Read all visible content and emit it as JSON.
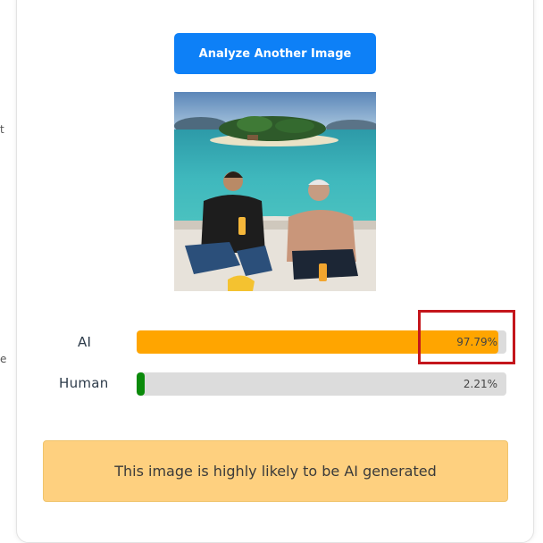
{
  "left_edge_fragments": [
    "t",
    "e"
  ],
  "analyze_button_label": "Analyze Another Image",
  "results": [
    {
      "label": "AI",
      "percent_text": "97.79%",
      "value": 97.79,
      "color": "#ffa500"
    },
    {
      "label": "Human",
      "percent_text": "2.21%",
      "value": 2.21,
      "color": "#0a8a0a"
    }
  ],
  "verdict_text": "This image is highly likely to be AI generated",
  "colors": {
    "button": "#0d80f7",
    "highlight_box": "#c4161c",
    "verdict_bg": "#fed07f",
    "bar_track": "#dcdcdc"
  }
}
